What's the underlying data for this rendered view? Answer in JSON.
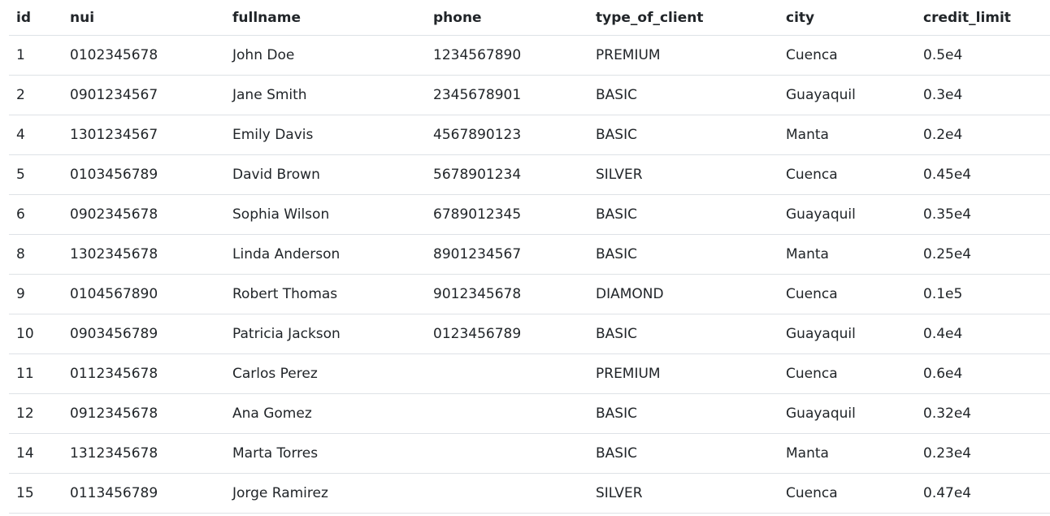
{
  "table": {
    "columns": [
      "id",
      "nui",
      "fullname",
      "phone",
      "type_of_client",
      "city",
      "credit_limit"
    ],
    "rows": [
      [
        "1",
        "0102345678",
        "John Doe",
        "1234567890",
        "PREMIUM",
        "Cuenca",
        "0.5e4"
      ],
      [
        "2",
        "0901234567",
        "Jane Smith",
        "2345678901",
        "BASIC",
        "Guayaquil",
        "0.3e4"
      ],
      [
        "4",
        "1301234567",
        "Emily Davis",
        "4567890123",
        "BASIC",
        "Manta",
        "0.2e4"
      ],
      [
        "5",
        "0103456789",
        "David Brown",
        "5678901234",
        "SILVER",
        "Cuenca",
        "0.45e4"
      ],
      [
        "6",
        "0902345678",
        "Sophia Wilson",
        "6789012345",
        "BASIC",
        "Guayaquil",
        "0.35e4"
      ],
      [
        "8",
        "1302345678",
        "Linda Anderson",
        "8901234567",
        "BASIC",
        "Manta",
        "0.25e4"
      ],
      [
        "9",
        "0104567890",
        "Robert Thomas",
        "9012345678",
        "DIAMOND",
        "Cuenca",
        "0.1e5"
      ],
      [
        "10",
        "0903456789",
        "Patricia Jackson",
        "0123456789",
        "BASIC",
        "Guayaquil",
        "0.4e4"
      ],
      [
        "11",
        "0112345678",
        "Carlos Perez",
        "",
        "PREMIUM",
        "Cuenca",
        "0.6e4"
      ],
      [
        "12",
        "0912345678",
        "Ana Gomez",
        "",
        "BASIC",
        "Guayaquil",
        "0.32e4"
      ],
      [
        "14",
        "1312345678",
        "Marta Torres",
        "",
        "BASIC",
        "Manta",
        "0.23e4"
      ],
      [
        "15",
        "0113456789",
        "Jorge Ramirez",
        "",
        "SILVER",
        "Cuenca",
        "0.47e4"
      ]
    ]
  },
  "colors": {
    "text": "#212529",
    "row_border": "#dee2e6",
    "background": "#ffffff"
  }
}
